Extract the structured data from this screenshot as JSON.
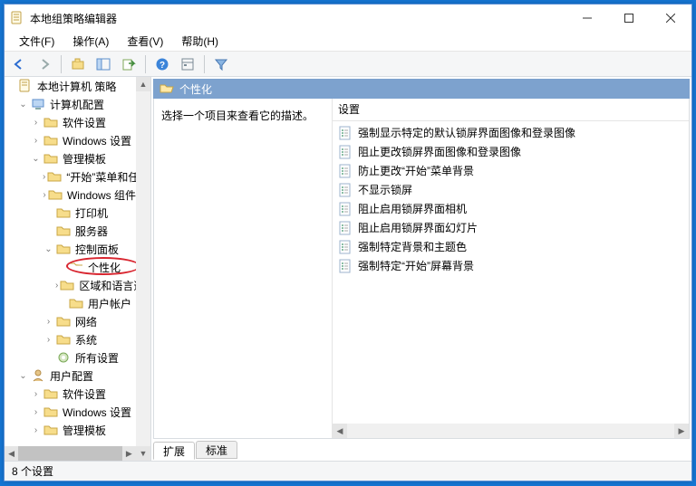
{
  "window": {
    "title": "本地组策略编辑器"
  },
  "menubar": {
    "file": "文件(F)",
    "action": "操作(A)",
    "view": "查看(V)",
    "help": "帮助(H)"
  },
  "tree": {
    "root": "本地计算机 策略",
    "computer_config": "计算机配置",
    "sw_settings1": "软件设置",
    "win_settings1": "Windows 设置",
    "admin_templates1": "管理模板",
    "start_menu": "“开始”菜单和任务栏",
    "win_components": "Windows 组件",
    "printers": "打印机",
    "servers": "服务器",
    "control_panel": "控制面板",
    "personalization": "个性化",
    "region_lang": "区域和语言选项",
    "user_accounts": "用户帐户",
    "network": "网络",
    "system": "系统",
    "all_settings": "所有设置",
    "user_config": "用户配置",
    "sw_settings2": "软件设置",
    "win_settings2": "Windows 设置",
    "admin_templates2": "管理模板"
  },
  "right": {
    "header": "个性化",
    "prompt": "选择一个项目来查看它的描述。",
    "col_header": "设置",
    "items": [
      "强制显示特定的默认锁屏界面图像和登录图像",
      "阻止更改锁屏界面图像和登录图像",
      "防止更改“开始”菜单背景",
      "不显示锁屏",
      "阻止启用锁屏界面相机",
      "阻止启用锁屏界面幻灯片",
      "强制特定背景和主题色",
      "强制特定“开始”屏幕背景"
    ],
    "tab_extended": "扩展",
    "tab_standard": "标准"
  },
  "status": "8 个设置"
}
